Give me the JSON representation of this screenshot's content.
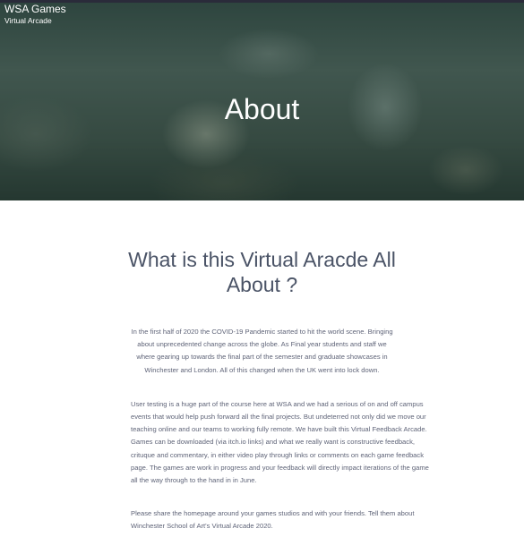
{
  "header": {
    "site_title": "WSA Games",
    "site_subtitle": "Virtual Arcade",
    "hero_title": "About"
  },
  "main": {
    "heading": "What is this Virtual Aracde All About ?",
    "paragraphs": [
      "In the first half of 2020 the COVID-19 Pandemic started to hit the world scene. Bringing about unprecedented change across the globe. As Final year students and staff we where gearing up towards the final part of the semester and graduate showcases in Winchester and London. All of this changed when the UK went into lock down.",
      "User testing is a huge part of the course here at WSA and we had a serious of on and off campus events that would help push forward all the final projects. But undeterred not only did we move our teaching online and our teams to working fully remote. We have built this Virtual Feedback Arcade. Games can be downloaded (via itch.io links) and what we really want is constructive feedback, crituque and commentary, in either video play through links or comments on each game feedback page. The games are work in progress and your feedback will directly impact iterations of the game all the way through to the hand in in June.",
      "Please share the homepage around your games studios and with your friends. Tell them about Winchester School of Art's Virtual Arcade 2020."
    ]
  },
  "colors": {
    "hero_overlay": "#144137",
    "heading_text": "#4a5366",
    "body_text": "#5f6478",
    "top_bar": "#2a2b3a"
  }
}
